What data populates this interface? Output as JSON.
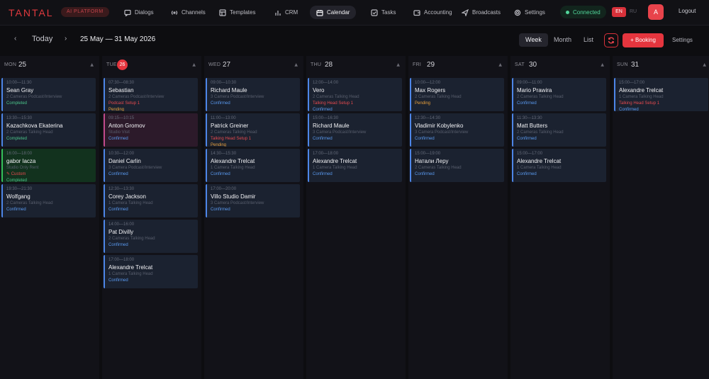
{
  "header": {
    "logo": "TANTAL",
    "badge": "AI PLATFORM",
    "nav": [
      {
        "label": "Dialogs",
        "icon": "chat-icon"
      },
      {
        "label": "Channels",
        "icon": "broadcast-icon"
      },
      {
        "label": "Templates",
        "icon": "template-icon"
      },
      {
        "label": "CRM",
        "icon": "bar-chart-icon"
      },
      {
        "label": "Calendar",
        "icon": "calendar-icon",
        "active": true
      },
      {
        "label": "Tasks",
        "icon": "checkbox-icon"
      },
      {
        "label": "Accounting",
        "icon": "wallet-icon"
      },
      {
        "label": "Broadcasts",
        "icon": "send-icon"
      },
      {
        "label": "Settings",
        "icon": "gear-icon"
      }
    ],
    "status": "Connected",
    "lang_active": "EN",
    "lang_other": "RU",
    "avatar": "A",
    "logout": "Logout"
  },
  "toolbar": {
    "prev": "‹",
    "next": "›",
    "today": "Today",
    "range": "25 May — 31 May 2026",
    "views": [
      "Week",
      "Month",
      "List"
    ],
    "active_view": "Week",
    "booking": "+ Booking",
    "settings": "Settings"
  },
  "colors": {
    "accent": "#e5353e",
    "confirmed": "#5a9af0",
    "pending": "#e8a03c",
    "completed": "#4bc48a"
  },
  "days": [
    {
      "name": "MON",
      "num": "25",
      "events": [
        {
          "time": "10:00—11:30",
          "name": "Sean Gray",
          "service": "2 Cameras Podcast/Interview",
          "status": "Completed",
          "status_class": "completed"
        },
        {
          "time": "13:30—15:30",
          "name": "Kazachkova Ekaterina",
          "service": "2 Cameras Talking Head",
          "status": "Completed",
          "status_class": "completed"
        },
        {
          "time": "16:00—18:00",
          "name": "gabor lacza",
          "service": "Studio Only Rent",
          "extra": "✎ Custom",
          "status": "Completed",
          "status_class": "completed",
          "style": "green"
        },
        {
          "time": "19:30—21:30",
          "name": "Wolfgang",
          "service": "2 Cameras Talking Head",
          "status": "Confirmed",
          "status_class": "confirmed"
        }
      ]
    },
    {
      "name": "TUE",
      "num": "26",
      "today": true,
      "events": [
        {
          "time": "07:30—08:30",
          "name": "Sebastian",
          "service": "2 Cameras Podcast/Interview",
          "extra": "Podcast Setup 1",
          "status": "Pending",
          "status_class": "pending"
        },
        {
          "time": "09:15—10:15",
          "name": "Anton Gromov",
          "service": "Studio Visit",
          "status": "Confirmed",
          "status_class": "confirmed",
          "style": "pink"
        },
        {
          "time": "10:30—12:00",
          "name": "Daniel Carlin",
          "service": "3 Camera Podcast/Interview",
          "status": "Confirmed",
          "status_class": "confirmed"
        },
        {
          "time": "12:30—13:30",
          "name": "Corey Jackson",
          "service": "1 Camera Talking Head",
          "status": "Confirmed",
          "status_class": "confirmed"
        },
        {
          "time": "14:00—16:00",
          "name": "Pat Divilly",
          "service": "2 Cameras Talking Head",
          "status": "Confirmed",
          "status_class": "confirmed"
        },
        {
          "time": "17:00—18:00",
          "name": "Alexandre Trelcat",
          "service": "1 Camera Talking Head",
          "status": "Confirmed",
          "status_class": "confirmed"
        }
      ]
    },
    {
      "name": "WED",
      "num": "27",
      "events": [
        {
          "time": "09:00—10:30",
          "name": "Richard Maule",
          "service": "3 Camera Podcast/Interview",
          "status": "Confirmed",
          "status_class": "confirmed"
        },
        {
          "time": "11:00—13:00",
          "name": "Patrick Greiner",
          "service": "2 Cameras Talking Head",
          "extra": "Talking Head Setup 1",
          "status": "Pending",
          "status_class": "pending"
        },
        {
          "time": "14:30—15:30",
          "name": "Alexandre Trelcat",
          "service": "1 Camera Talking Head",
          "status": "Confirmed",
          "status_class": "confirmed"
        },
        {
          "time": "17:00—20:00",
          "name": "Villo Studio Damir",
          "service": "3 Camera Podcast/Interview",
          "status": "Confirmed",
          "status_class": "confirmed"
        }
      ]
    },
    {
      "name": "THU",
      "num": "28",
      "events": [
        {
          "time": "12:00—14:00",
          "name": "Vero",
          "service": "2 Cameras Talking Head",
          "extra": "Talking Head Setup 1",
          "status": "Confirmed",
          "status_class": "confirmed"
        },
        {
          "time": "15:00—16:30",
          "name": "Richard Maule",
          "service": "3 Camera Podcast/Interview",
          "status": "Confirmed",
          "status_class": "confirmed"
        },
        {
          "time": "17:00—18:00",
          "name": "Alexandre Trelcat",
          "service": "1 Camera Talking Head",
          "status": "Confirmed",
          "status_class": "confirmed"
        }
      ]
    },
    {
      "name": "FRI",
      "num": "29",
      "events": [
        {
          "time": "10:00—12:00",
          "name": "Max Rogers",
          "service": "2 Cameras Talking Head",
          "status": "Pending",
          "status_class": "pending"
        },
        {
          "time": "12:30—14:30",
          "name": "Vladimir Kobylenko",
          "service": "3 Camera Podcast/Interview",
          "status": "Confirmed",
          "status_class": "confirmed"
        },
        {
          "time": "15:00—19:00",
          "name": "Натали Леру",
          "service": "2 Cameras Talking Head",
          "status": "Confirmed",
          "status_class": "confirmed"
        }
      ]
    },
    {
      "name": "SAT",
      "num": "30",
      "events": [
        {
          "time": "09:00—11:00",
          "name": "Mario Prawira",
          "service": "2 Cameras Talking Head",
          "status": "Confirmed",
          "status_class": "confirmed"
        },
        {
          "time": "11:30—13:30",
          "name": "Matt Butters",
          "service": "2 Cameras Talking Head",
          "status": "Confirmed",
          "status_class": "confirmed"
        },
        {
          "time": "15:00—17:00",
          "name": "Alexandre Trelcat",
          "service": "1 Camera Talking Head",
          "status": "Confirmed",
          "status_class": "confirmed"
        }
      ]
    },
    {
      "name": "SUN",
      "num": "31",
      "events": [
        {
          "time": "15:00—17:00",
          "name": "Alexandre Trelcat",
          "service": "1 Camera Talking Head",
          "extra": "Talking Head Setup 1",
          "status": "Confirmed",
          "status_class": "confirmed"
        }
      ]
    }
  ]
}
